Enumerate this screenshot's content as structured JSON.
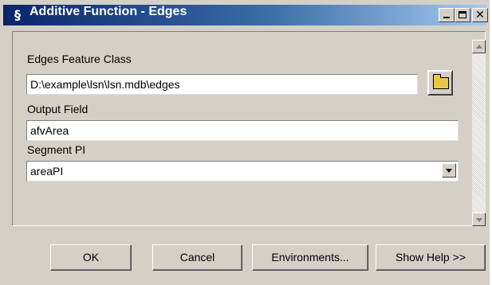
{
  "window": {
    "title": "Additive Function - Edges",
    "close_glyph": "✕"
  },
  "fields": {
    "edges_label": "Edges Feature Class",
    "edges_value": "D:\\example\\lsn\\lsn.mdb\\edges",
    "output_label": "Output Field",
    "output_value": "afvArea",
    "segment_label": "Segment PI",
    "segment_value": "areaPI"
  },
  "icons": {
    "app_icon": "script-tool-icon",
    "browse_icon": "open-folder-icon"
  },
  "buttons": {
    "ok": "OK",
    "cancel": "Cancel",
    "environments": "Environments...",
    "help": "Show Help >>"
  },
  "colors": {
    "titlebar_start": "#0a246a",
    "titlebar_end": "#a6caf0",
    "face": "#d4d0c8"
  }
}
